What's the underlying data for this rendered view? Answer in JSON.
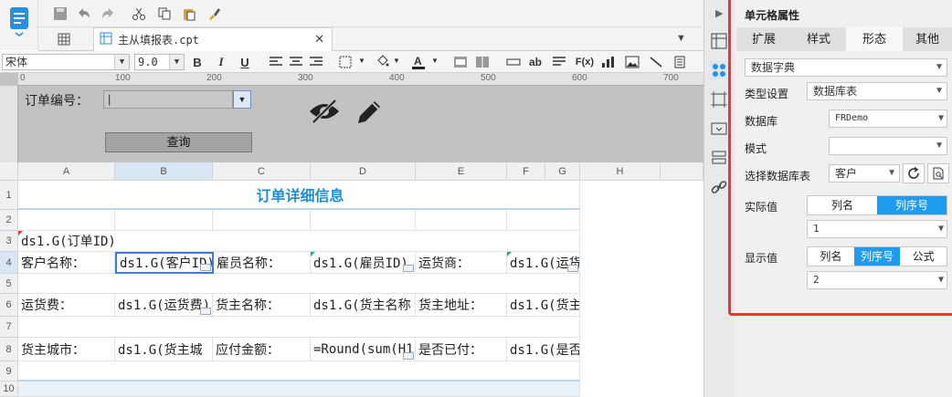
{
  "toolbar": {
    "icons": [
      "app-logo-icon",
      "save-icon",
      "undo-icon",
      "redo-icon",
      "cut-icon",
      "copy-icon",
      "paste-icon",
      "format-brush-icon"
    ]
  },
  "document_tab": {
    "label": "主从填报表.cpt"
  },
  "format": {
    "font_family": "宋体",
    "font_size": "9.0",
    "bold": "B",
    "italic": "I",
    "underline": "U",
    "text_btn_ab": "ab",
    "formula_btn": "F(x)"
  },
  "ruler": {
    "ticks": [
      "0",
      "100",
      "200",
      "300",
      "400",
      "500",
      "600",
      "700"
    ]
  },
  "param_panel": {
    "order_id_label": "订单编号：",
    "order_id_value": "|",
    "query_button": "查询"
  },
  "grid": {
    "columns": [
      "A",
      "B",
      "C",
      "D",
      "E",
      "F",
      "G",
      "H"
    ],
    "rows": [
      "1",
      "2",
      "3",
      "4",
      "5",
      "6",
      "7",
      "8",
      "9",
      "10"
    ],
    "title": "订单详细信息",
    "r3_a": "ds1.G(订单ID)",
    "r4_a": "客户名称：",
    "r4_b": "ds1.G(客户ID)",
    "r4_c": "雇员名称：",
    "r4_d": "ds1.G(雇员ID)",
    "r4_e": "运货商：",
    "r4_f": "ds1.G(运货",
    "r6_a": "运货费：",
    "r6_b": "ds1.G(运货费)",
    "r6_c": "货主名称：",
    "r6_d": "ds1.G(货主名称",
    "r6_e": "货主地址：",
    "r6_f": "ds1.G(货主",
    "r8_a": "货主城市：",
    "r8_b": "ds1.G(货主城",
    "r8_c": "应付金额：",
    "r8_d": "=Round(sum(H1",
    "r8_e": "是否已付：",
    "r8_f": "ds1.G(是否"
  },
  "properties": {
    "header": "单元格属性",
    "tabs": [
      "扩展",
      "样式",
      "形态",
      "其他"
    ],
    "active_tab": "形态",
    "widget_type": "数据字典",
    "type_setting_label": "类型设置",
    "type_setting_value": "数据库表",
    "database_label": "数据库",
    "database_value": "FRDemo",
    "schema_label": "模式",
    "schema_value": "",
    "table_label": "选择数据库表",
    "table_value": "客户",
    "actual_label": "实际值",
    "actual_options": [
      "列名",
      "列序号"
    ],
    "actual_selected": "列序号",
    "actual_value": "1",
    "display_label": "显示值",
    "display_options": [
      "列名",
      "列序号",
      "公式"
    ],
    "display_selected": "列序号",
    "display_value": "2"
  },
  "colors": {
    "accent": "#1e9cf0",
    "title": "#1d8fd1",
    "highlight_box": "#e53935",
    "param_bg": "#c2c2c2"
  }
}
